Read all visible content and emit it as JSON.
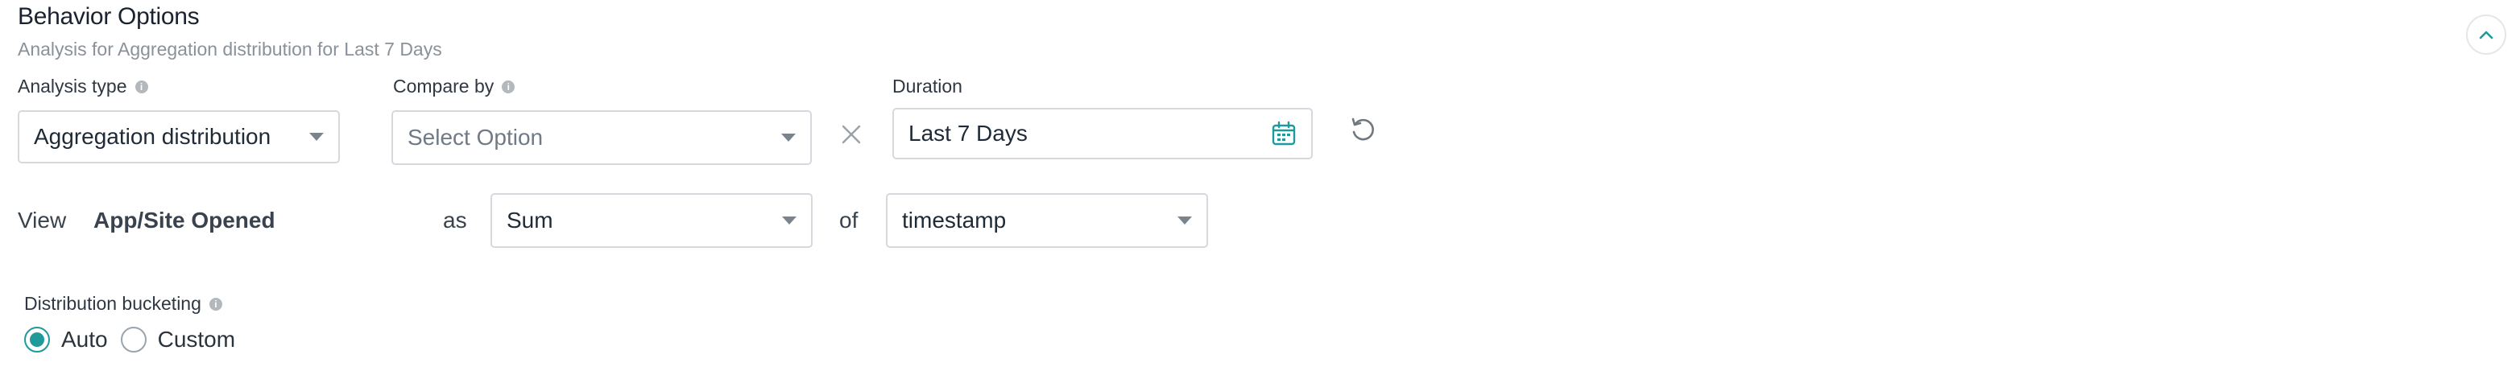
{
  "header": {
    "title": "Behavior Options",
    "subtitle": "Analysis for Aggregation distribution for Last 7 Days"
  },
  "fields": {
    "analysis_type": {
      "label": "Analysis type",
      "value": "Aggregation distribution"
    },
    "compare_by": {
      "label": "Compare by",
      "placeholder": "Select Option"
    },
    "duration": {
      "label": "Duration",
      "value": "Last 7 Days"
    }
  },
  "view_row": {
    "view_label": "View",
    "event_name": "App/Site Opened",
    "as_label": "as",
    "aggregation": "Sum",
    "of_label": "of",
    "property": "timestamp"
  },
  "bucketing": {
    "label": "Distribution bucketing",
    "options": [
      {
        "label": "Auto",
        "selected": true
      },
      {
        "label": "Custom",
        "selected": false
      }
    ]
  },
  "colors": {
    "accent": "#1f9a9a",
    "border": "#d5d9dd",
    "muted": "#8a9199"
  },
  "icons": [
    "chevron-up-icon",
    "info-icon",
    "caret-down-icon",
    "close-icon",
    "calendar-icon",
    "reset-icon"
  ]
}
